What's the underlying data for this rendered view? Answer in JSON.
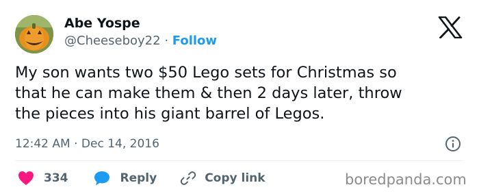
{
  "author": {
    "name": "Abe Yospe",
    "handle": "@Cheeseboy22",
    "separator": "·",
    "follow_label": "Follow",
    "avatar_icon": "pumpkin-avatar-icon"
  },
  "platform": {
    "logo": "x-logo-icon"
  },
  "tweet": {
    "text": "My son wants two $50 Lego sets for Christmas so\nthat he can make them & then 2 days later, throw\nthe pieces into his giant barrel of Legos.",
    "time": "12:42 AM",
    "separator": "·",
    "date": "Dec 14, 2016",
    "info_icon": "info-icon"
  },
  "actions": {
    "likes_count": "334",
    "reply_label": "Reply",
    "copy_link_label": "Copy link",
    "icons": [
      "heart-icon",
      "reply-bubble-icon",
      "link-icon"
    ]
  },
  "colors": {
    "accent": "#1d9bf0",
    "like": "#f91880",
    "text": "#0f1419",
    "muted": "#536471"
  },
  "watermark": "boredpanda.com"
}
